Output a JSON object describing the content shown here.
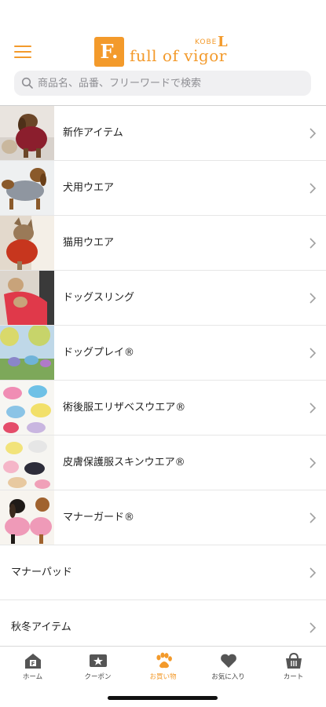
{
  "brand": {
    "logo_letter": "F.",
    "name": "full of vigor",
    "kobe": "KOBE",
    "accent": "#f39a2b"
  },
  "search": {
    "placeholder": "商品名、品番、フリーワードで検索",
    "value": ""
  },
  "categories": [
    {
      "label": "新作アイテム",
      "thumb": "dog-brown-red",
      "has_image": true
    },
    {
      "label": "犬用ウエア",
      "thumb": "dachshund-gray",
      "has_image": true
    },
    {
      "label": "猫用ウエア",
      "thumb": "cat-red",
      "has_image": true
    },
    {
      "label": "ドッグスリング",
      "thumb": "dog-sling-red",
      "has_image": true
    },
    {
      "label": "ドッグプレイ®",
      "thumb": "dogs-park",
      "has_image": true
    },
    {
      "label": "術後服エリザベスウエア®",
      "thumb": "dogs-yellow",
      "has_image": true
    },
    {
      "label": "皮膚保護服スキンウエア®",
      "thumb": "dogs-pastel",
      "has_image": true
    },
    {
      "label": "マナーガード®",
      "thumb": "dachshunds-pink",
      "has_image": true
    },
    {
      "label": "マナーパッド",
      "has_image": false
    },
    {
      "label": "秋冬アイテム",
      "has_image": false
    }
  ],
  "tabbar": {
    "items": [
      {
        "label": "ホーム",
        "icon": "home-icon",
        "active": false
      },
      {
        "label": "クーポン",
        "icon": "coupon-icon",
        "active": false
      },
      {
        "label": "お買い物",
        "icon": "paw-icon",
        "active": true
      },
      {
        "label": "お気に入り",
        "icon": "heart-icon",
        "active": false
      },
      {
        "label": "カート",
        "icon": "cart-icon",
        "active": false
      }
    ],
    "active_color": "#f39a2b",
    "inactive_color": "#444444"
  }
}
